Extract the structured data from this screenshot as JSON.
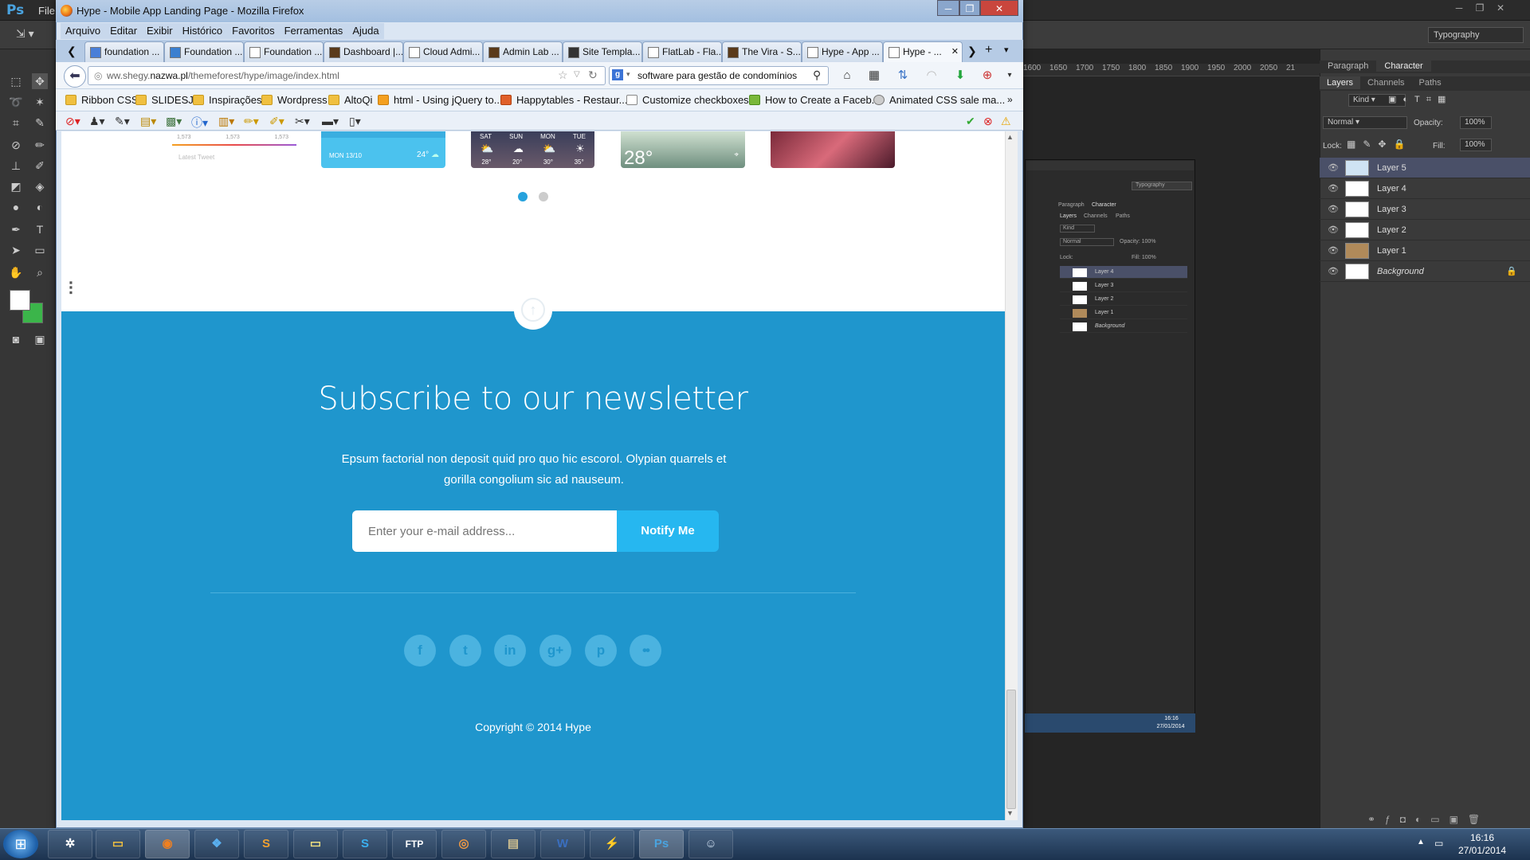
{
  "photoshop": {
    "logo": "Ps",
    "menu_file": "File",
    "workspace": "Typography",
    "ruler_ticks": [
      "1600",
      "1650",
      "1700",
      "1750",
      "1800",
      "1850",
      "1900",
      "1950",
      "2000",
      "2050",
      "21"
    ],
    "panel_tabs": [
      "Paragraph",
      "Character"
    ],
    "layer_tabs": [
      "Layers",
      "Channels",
      "Paths"
    ],
    "kind_label": "Kind",
    "blend_mode": "Normal",
    "opacity_label": "Opacity:",
    "opacity_value": "100%",
    "lock_label": "Lock:",
    "fill_label": "Fill:",
    "fill_value": "100%",
    "layers": [
      "Layer 5",
      "Layer 4",
      "Layer 3",
      "Layer 2",
      "Layer 1",
      "Background"
    ],
    "nested": {
      "workspace": "Typography",
      "panel_tabs": [
        "Paragraph",
        "Character"
      ],
      "layer_tabs": [
        "Layers",
        "Channels",
        "Paths"
      ],
      "kind_label": "Kind",
      "blend_mode": "Normal",
      "opacity": "Opacity: 100%",
      "lock": "Lock:",
      "fill": "Fill: 100%",
      "layers": [
        "Layer 4",
        "Layer 3",
        "Layer 2",
        "Layer 1",
        "Background"
      ],
      "time": "16:16",
      "date": "27/01/2014"
    }
  },
  "firefox": {
    "window_title": "Hype - Mobile App Landing Page - Mozilla Firefox",
    "menu": [
      "Arquivo",
      "Editar",
      "Exibir",
      "Histórico",
      "Favoritos",
      "Ferramentas",
      "Ajuda"
    ],
    "tabs": [
      "foundation ...",
      "Foundation ...",
      "Foundation ...",
      "Dashboard |...",
      "Cloud Admi...",
      "Admin Lab ...",
      "Site Templa...",
      "FlatLab - Fla...",
      "The Vira - S...",
      "Hype - App ...",
      "Hype - ..."
    ],
    "url_prefix": "ww.shegy.",
    "url_domain": "nazwa.pl",
    "url_path": "/themeforest/hype/image/index.html",
    "search_query": "software para gestão de condomínios",
    "bookmarks": [
      "Ribbon CSS",
      "SLIDESJS",
      "Inspirações",
      "Wordpress",
      "AltoQi",
      "html - Using jQuery to...",
      "Happytables - Restaur...",
      "Customize checkboxes...",
      "How to Create a Faceb...",
      "Animated CSS sale ma..."
    ]
  },
  "page": {
    "slider_cards": {
      "stats": [
        "1,573",
        "1,573",
        "1,573"
      ],
      "latest_tweet": "Latest Tweet",
      "weather_date": "MON 13/10",
      "weather_temp": "24°",
      "forecast_days": [
        "SAT",
        "SUN",
        "MON",
        "TUE"
      ],
      "forecast_temps": [
        "28°",
        "20°",
        "30°",
        "35°"
      ],
      "big_temp": "28°"
    },
    "newsletter_title": "Subscribe to our newsletter",
    "newsletter_desc": "Epsum factorial non deposit quid pro quo hic escorol. Olypian quarrels et gorilla congolium sic ad nauseum.",
    "email_placeholder": "Enter your e-mail address...",
    "notify_label": "Notify Me",
    "social": [
      "f",
      "t",
      "in",
      "g+",
      "p",
      "••"
    ],
    "copyright": "Copyright © 2014 Hype"
  },
  "taskbar": {
    "time": "16:16",
    "date": "27/01/2014"
  }
}
